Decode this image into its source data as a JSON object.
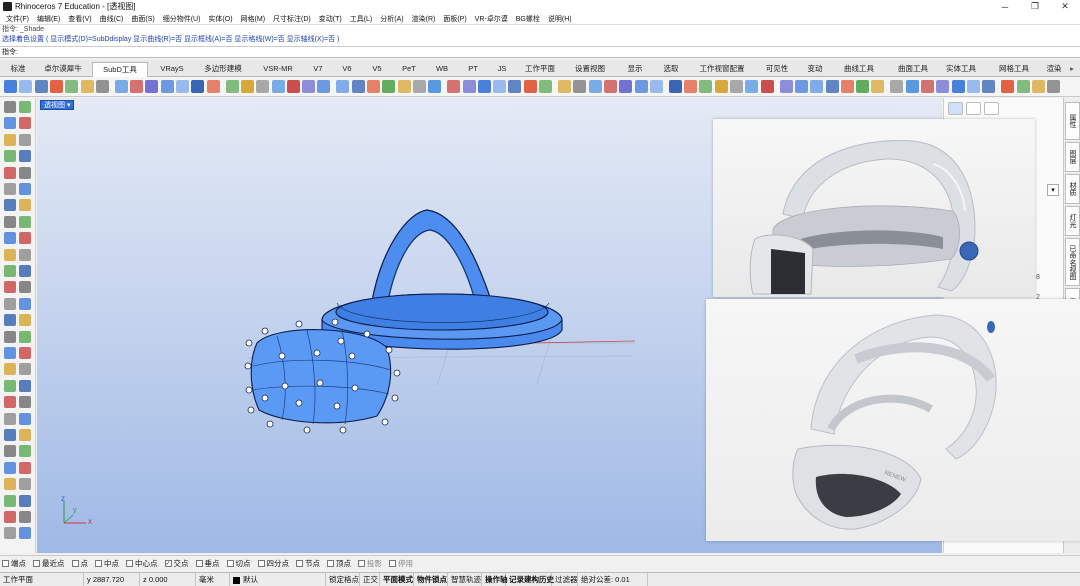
{
  "window": {
    "title": "Rhinoceros 7 Education - [透视图]",
    "minimize": "─",
    "maximize": "❐",
    "close": "✕"
  },
  "menu": [
    "文件(F)",
    "编辑(E)",
    "查看(V)",
    "曲线(C)",
    "曲面(S)",
    "细分物件(U)",
    "实体(O)",
    "网格(M)",
    "尺寸标注(D)",
    "变动(T)",
    "工具(L)",
    "分析(A)",
    "渲染(R)",
    "面板(P)",
    "VR-卓尔谟",
    "BG螺栓",
    "说明(H)"
  ],
  "command": {
    "history_line": "指令: _Shade",
    "history_options": "选择着色设置 ( 显示模式(D)=SubDdisplay  显示曲线(R)=否  显示框线(A)=否  显示格线(W)=否  显示轴线(X)=否 )",
    "prompt": "指令:"
  },
  "tabs": [
    "标准",
    "卓尔谟犀牛",
    "SubD工具",
    "VRayS",
    "多边形建模",
    "VSR-MR",
    "V7",
    "V6",
    "V5",
    "PeT",
    "WB",
    "PT",
    "JS",
    "工作平面",
    "设置视图",
    "显示",
    "选取",
    "工作视窗配置",
    "可见性",
    "变动",
    "曲线工具",
    "曲面工具",
    "实体工具",
    "网格工具",
    "渲染"
  ],
  "active_tab": "SubD工具",
  "tab_scroll": "▸",
  "viewport": {
    "label": "透视图",
    "label_arrow": "▾",
    "axis_x": "x",
    "axis_y": "y",
    "axis_z": "z"
  },
  "osnap": [
    {
      "label": "端点",
      "checked": false
    },
    {
      "label": "最近点",
      "checked": false
    },
    {
      "label": "点",
      "checked": false
    },
    {
      "label": "中点",
      "checked": false
    },
    {
      "label": "中心点",
      "checked": false
    },
    {
      "label": "交点",
      "checked": true
    },
    {
      "label": "垂点",
      "checked": false
    },
    {
      "label": "切点",
      "checked": false
    },
    {
      "label": "四分点",
      "checked": false
    },
    {
      "label": "节点",
      "checked": false
    },
    {
      "label": "顶点",
      "checked": false
    },
    {
      "label": "投影",
      "checked": false,
      "disabled": true
    },
    {
      "label": "停用",
      "checked": false,
      "disabled": true
    }
  ],
  "status": {
    "cplane": "工作平面",
    "y": "y 2887.720",
    "z": "z 0.000",
    "units": "毫米",
    "layer": "默认",
    "items": [
      "锁定格点",
      "正交",
      "平面模式",
      "物件锁点",
      "智慧轨迹",
      "操作轴",
      "记录建构历史",
      "过滤器"
    ],
    "bold_items": [
      "平面模式",
      "物件锁点",
      "操作轴",
      "记录建构历史"
    ],
    "tolerance": "绝对公差: 0.01"
  },
  "right_panel_tabs": [
    "属性",
    "图层",
    "材质",
    "灯光",
    "已命名视图",
    "显示"
  ],
  "right_panel_side_numbers": [
    "8",
    "2"
  ],
  "right_panel_dropdown": "▾",
  "colors": {
    "model_blue": "#4d8df0",
    "viewport_top": "#e4eaf5",
    "viewport_bottom": "#9fb9e6",
    "label_blue": "#2f6fd8",
    "command_blue": "#1a3fb8"
  }
}
